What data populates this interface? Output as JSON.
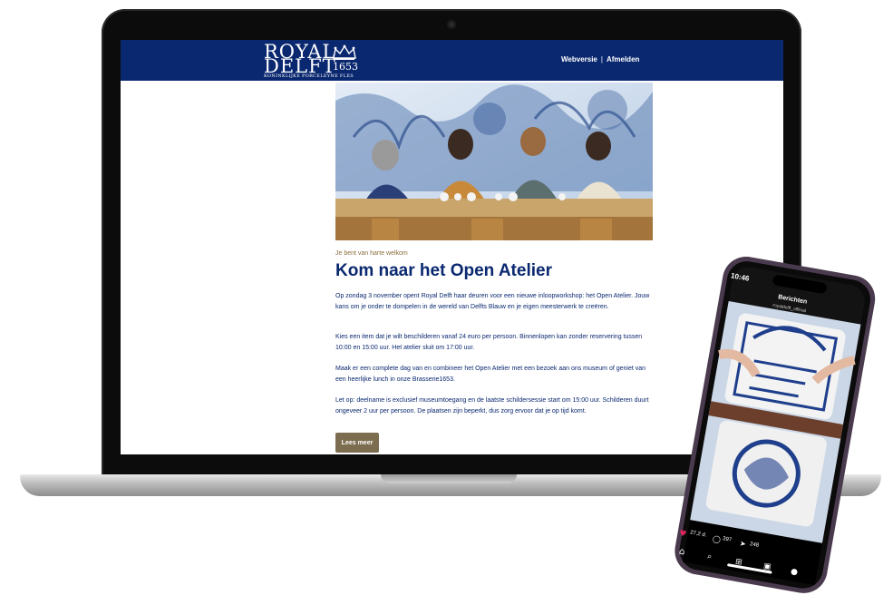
{
  "site": {
    "logo_top": "ROYAL",
    "logo_bottom": "DELFT",
    "logo_year": "1653",
    "logo_tagline": "KONINKLIJKE PORCELEYNE FLES",
    "nav": [
      {
        "label": "Webversie"
      },
      {
        "label": "Afmelden"
      }
    ],
    "nav_separator": "|"
  },
  "article": {
    "eyebrow": "Je bent van harte welkom",
    "title": "Kom naar het Open Atelier",
    "paragraphs": [
      "Op zondag 3 november opent Royal Delft haar deuren voor een nieuwe inloopworkshop: het Open Atelier. Jouw kans om je onder te dompelen in de wereld van Delfts Blauw en je eigen meesterwerk te creëren.",
      "Kies een item dat je wilt beschilderen vanaf 24 euro per persoon. Binnenlopen kan zonder reservering tussen 10:00 en 15:00 uur. Het atelier sluit om 17:00 uur.",
      "Maak er een complete dag van en combineer het Open Atelier met een bezoek aan ons museum of geniet van een heerlijke lunch in onze Brasserie1653.",
      "Let op: deelname is exclusief museumtoegang en de laatste schildersessie start om 15:00 uur. Schilderen duurt ongeveer 2 uur per persoon. De plaatsen zijn beperkt, dus zorg ervoor dat je op tijd komt."
    ],
    "cta_label": "Lees meer"
  },
  "phone": {
    "time": "10:46",
    "header_title": "Berichten",
    "header_subtitle": "royaldelft_official",
    "likes": "27,2 d.",
    "comments": "397",
    "shares": "248"
  },
  "colors": {
    "brand_navy": "#0a2870",
    "cta_brown": "#7d6d50",
    "eyebrow_gold": "#8a6d3b"
  },
  "icons": [
    "crown-icon",
    "home-icon",
    "search-icon",
    "add-icon",
    "reels-icon",
    "profile-icon",
    "heart-icon",
    "comment-icon",
    "send-icon"
  ]
}
